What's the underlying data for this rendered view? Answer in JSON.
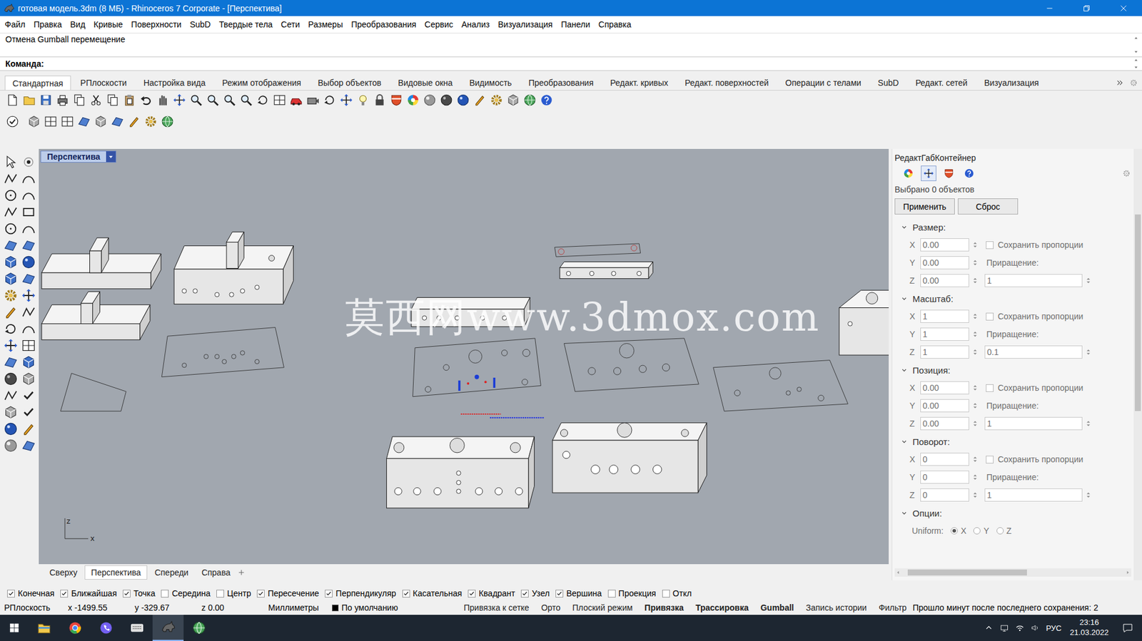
{
  "window": {
    "title": "готовая модель.3dm (8 МБ) - Rhinoceros 7 Corporate - [Перспектива]"
  },
  "menu": [
    "Файл",
    "Правка",
    "Вид",
    "Кривые",
    "Поверхности",
    "SubD",
    "Твердые тела",
    "Сети",
    "Размеры",
    "Преобразования",
    "Сервис",
    "Анализ",
    "Визуализация",
    "Панели",
    "Справка"
  ],
  "command": {
    "history": "Отмена Gumball перемещение",
    "prompt": "Команда:",
    "input": ""
  },
  "toolbar_tabs": [
    {
      "label": "Стандартная",
      "selected": true
    },
    {
      "label": "РПлоскости",
      "selected": false
    },
    {
      "label": "Настройка вида",
      "selected": false
    },
    {
      "label": "Режим отображения",
      "selected": false
    },
    {
      "label": "Выбор объектов",
      "selected": false
    },
    {
      "label": "Видовые окна",
      "selected": false
    },
    {
      "label": "Видимость",
      "selected": false
    },
    {
      "label": "Преобразования",
      "selected": false
    },
    {
      "label": "Редакт. кривых",
      "selected": false
    },
    {
      "label": "Редакт. поверхностей",
      "selected": false
    },
    {
      "label": "Операции с телами",
      "selected": false
    },
    {
      "label": "SubD",
      "selected": false
    },
    {
      "label": "Редакт. сетей",
      "selected": false
    },
    {
      "label": "Визуализация",
      "selected": false
    }
  ],
  "viewport": {
    "title": "Перспектива",
    "watermark": "莫西网www.3dmox.com",
    "axes": [
      "z",
      "x"
    ]
  },
  "viewport_tabs": [
    {
      "label": "Сверху",
      "selected": false
    },
    {
      "label": "Перспектива",
      "selected": true
    },
    {
      "label": "Спереди",
      "selected": false
    },
    {
      "label": "Справа",
      "selected": false
    }
  ],
  "panel": {
    "title": "РедактГабКонтейнер",
    "tabs": [
      {
        "selected": false
      },
      {
        "selected": true
      },
      {
        "selected": false
      },
      {
        "selected": false
      }
    ],
    "selection_info": "Выбрано 0 объектов",
    "buttons": [
      "Применить",
      "Сброс"
    ],
    "fields_disabled": true,
    "sections": [
      {
        "title": "Размер:",
        "expanded": true,
        "rows": [
          {
            "axis": "X",
            "value": "0.00"
          },
          {
            "axis": "Y",
            "value": "0.00"
          },
          {
            "axis": "Z",
            "value": "0.00"
          }
        ],
        "keep": {
          "label": "Сохранить пропорции",
          "checked": false
        },
        "increment": {
          "label": "Приращение:",
          "value": "1"
        }
      },
      {
        "title": "Масштаб:",
        "expanded": true,
        "rows": [
          {
            "axis": "X",
            "value": "1"
          },
          {
            "axis": "Y",
            "value": "1"
          },
          {
            "axis": "Z",
            "value": "1"
          }
        ],
        "keep": {
          "label": "Сохранить пропорции",
          "checked": false
        },
        "increment": {
          "label": "Приращение:",
          "value": "0.1"
        }
      },
      {
        "title": "Позиция:",
        "expanded": true,
        "rows": [
          {
            "axis": "X",
            "value": "0.00"
          },
          {
            "axis": "Y",
            "value": "0.00"
          },
          {
            "axis": "Z",
            "value": "0.00"
          }
        ],
        "keep": {
          "label": "Сохранить пропорции",
          "checked": false
        },
        "increment": {
          "label": "Приращение:",
          "value": "1"
        }
      },
      {
        "title": "Поворот:",
        "expanded": true,
        "rows": [
          {
            "axis": "X",
            "value": "0"
          },
          {
            "axis": "Y",
            "value": "0"
          },
          {
            "axis": "Z",
            "value": "0"
          }
        ],
        "keep": {
          "label": "Сохранить пропорции",
          "checked": false
        },
        "increment": {
          "label": "Приращение:",
          "value": "1"
        }
      }
    ],
    "options": {
      "title": "Опции:",
      "expanded": true,
      "label": "Uniform:",
      "choices": [
        {
          "label": "X",
          "selected": true
        },
        {
          "label": "Y",
          "selected": false
        },
        {
          "label": "Z",
          "selected": false
        }
      ]
    }
  },
  "osnaps": [
    {
      "label": "Конечная",
      "checked": true
    },
    {
      "label": "Ближайшая",
      "checked": true
    },
    {
      "label": "Точка",
      "checked": true
    },
    {
      "label": "Середина",
      "checked": false
    },
    {
      "label": "Центр",
      "checked": false
    },
    {
      "label": "Пересечение",
      "checked": true
    },
    {
      "label": "Перпендикуляр",
      "checked": true
    },
    {
      "label": "Касательная",
      "checked": true
    },
    {
      "label": "Квадрант",
      "checked": true
    },
    {
      "label": "Узел",
      "checked": true
    },
    {
      "label": "Вершина",
      "checked": true
    },
    {
      "label": "Проекция",
      "checked": false
    },
    {
      "label": "Откл",
      "checked": false
    }
  ],
  "status_bar": {
    "cplane": "РПлоскость",
    "coords": [
      "x -1499.55",
      "y -329.67",
      "z 0.00"
    ],
    "units": "Миллиметры",
    "layer": {
      "name": "По умолчанию",
      "color": "#000000"
    },
    "toggles": [
      {
        "label": "Привязка к сетке",
        "on": false
      },
      {
        "label": "Орто",
        "on": false
      },
      {
        "label": "Плоский режим",
        "on": false
      },
      {
        "label": "Привязка",
        "on": true
      },
      {
        "label": "Трассировка",
        "on": true
      },
      {
        "label": "Gumball",
        "on": true
      },
      {
        "label": "Запись истории",
        "on": false
      },
      {
        "label": "Фильтр",
        "on": false
      }
    ],
    "save_info": "Прошло минут после последнего сохранения: 2"
  },
  "taskbar": {
    "apps": [
      {
        "active": false
      },
      {
        "active": false
      },
      {
        "active": false
      },
      {
        "active": false
      },
      {
        "active": true
      },
      {
        "active": false
      }
    ],
    "language": "РУС",
    "time": "23:16",
    "date": "21.03.2022"
  }
}
